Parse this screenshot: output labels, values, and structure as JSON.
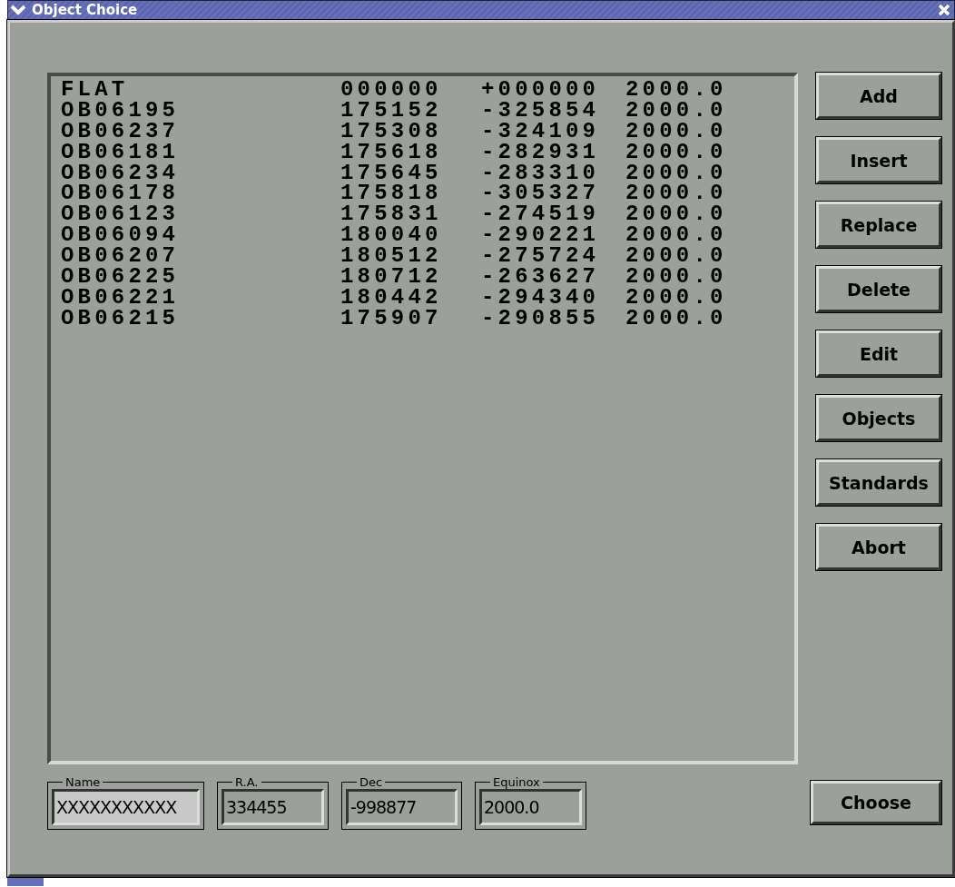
{
  "window": {
    "title": "Object Choice"
  },
  "objects": [
    {
      "name": "FLAT",
      "ra": "000000",
      "dec": "+000000",
      "equinox": "2000.0"
    },
    {
      "name": "OB06195",
      "ra": "175152",
      "dec": "-325854",
      "equinox": "2000.0"
    },
    {
      "name": "OB06237",
      "ra": "175308",
      "dec": "-324109",
      "equinox": "2000.0"
    },
    {
      "name": "OB06181",
      "ra": "175618",
      "dec": "-282931",
      "equinox": "2000.0"
    },
    {
      "name": "OB06234",
      "ra": "175645",
      "dec": "-283310",
      "equinox": "2000.0"
    },
    {
      "name": "OB06178",
      "ra": "175818",
      "dec": "-305327",
      "equinox": "2000.0"
    },
    {
      "name": "OB06123",
      "ra": "175831",
      "dec": "-274519",
      "equinox": "2000.0"
    },
    {
      "name": "OB06094",
      "ra": "180040",
      "dec": "-290221",
      "equinox": "2000.0"
    },
    {
      "name": "OB06207",
      "ra": "180512",
      "dec": "-275724",
      "equinox": "2000.0"
    },
    {
      "name": "OB06225",
      "ra": "180712",
      "dec": "-263627",
      "equinox": "2000.0"
    },
    {
      "name": "OB06221",
      "ra": "180442",
      "dec": "-294340",
      "equinox": "2000.0"
    },
    {
      "name": "OB06215",
      "ra": "175907",
      "dec": "-290855",
      "equinox": "2000.0"
    }
  ],
  "buttons": [
    "Add",
    "Insert",
    "Replace",
    "Delete",
    "Edit",
    "Objects",
    "Standards",
    "Abort"
  ],
  "fields": [
    {
      "label": "Name",
      "value": "XXXXXXXXXXX",
      "focused": true
    },
    {
      "label": "R.A.",
      "value": "334455",
      "focused": false
    },
    {
      "label": "Dec",
      "value": "-998877",
      "focused": false
    },
    {
      "label": "Equinox",
      "value": "2000.0",
      "focused": false
    }
  ],
  "choose_button": "Choose"
}
